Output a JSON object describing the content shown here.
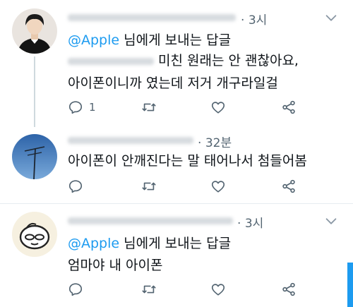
{
  "tweets": [
    {
      "time": "3시",
      "reply_prefix": "@Apple",
      "reply_suffix": "님에게 보내는 답글",
      "text_line1": "미친 원래는 안 괜찮아요,",
      "text_line2": "아이폰이니까 였는데 저거 개구라일걸",
      "reply_count": "1"
    },
    {
      "time": "32분",
      "text_line1": "아이폰이 안깨진다는 말 태어나서 첨들어봄"
    },
    {
      "time": "3시",
      "reply_prefix": "@Apple",
      "reply_suffix": "님에게 보내는 답글",
      "text_line1": "엄마야 내 아이폰"
    }
  ],
  "icons": [
    "more-icon",
    "reply-icon",
    "retweet-icon",
    "like-icon",
    "share-icon"
  ],
  "colors": {
    "accent": "#1d9bf0",
    "text": "#0f1419",
    "secondary": "#536471",
    "divider": "#e6ecf0"
  }
}
